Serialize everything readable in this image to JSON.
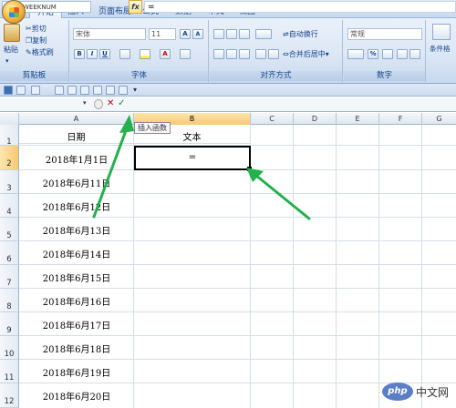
{
  "tabs": [
    {
      "label": "开始",
      "active": true
    },
    {
      "label": "插入"
    },
    {
      "label": "页面布局"
    },
    {
      "label": "公式"
    },
    {
      "label": "数据"
    },
    {
      "label": "审阅"
    },
    {
      "label": "视图"
    }
  ],
  "ribbon": {
    "clipboard": {
      "paste": "粘贴",
      "cut": "剪切",
      "copy": "复制",
      "format_painter": "格式刷",
      "label": "剪贴板"
    },
    "font": {
      "font_name": "宋体",
      "font_size": "11",
      "bold": "B",
      "italic": "I",
      "underline": "U",
      "grow": "A",
      "shrink": "A",
      "font_color": "A",
      "label": "字体"
    },
    "alignment": {
      "wrap_text": "自动换行",
      "merge_center": "合并后居中",
      "label": "对齐方式"
    },
    "number": {
      "format": "常规",
      "percent": "%",
      "label": "数字"
    },
    "styles": {
      "conditional": "条件格"
    }
  },
  "formula_bar": {
    "name_box": "WEEKNUM",
    "fx": "fx",
    "content": "=",
    "tooltip": "插入函数"
  },
  "sheet": {
    "columns": [
      "A",
      "B",
      "C",
      "D",
      "E",
      "F",
      "G"
    ],
    "rows": [
      "1",
      "2",
      "3",
      "4",
      "5",
      "6",
      "7",
      "8",
      "9",
      "10",
      "11",
      "12"
    ],
    "header_a": "日期",
    "header_b": "文本",
    "active_cell_value": "=",
    "dates": [
      "2018年1月1日",
      "2018年6月11日",
      "2018年6月12日",
      "2018年6月13日",
      "2018年6月14日",
      "2018年6月15日",
      "2018年6月16日",
      "2018年6月17日",
      "2018年6月18日",
      "2018年6月19日",
      "2018年6月20日"
    ]
  },
  "annotation_color": "#22b14c",
  "watermark": {
    "logo": "php",
    "text": "中文网"
  }
}
